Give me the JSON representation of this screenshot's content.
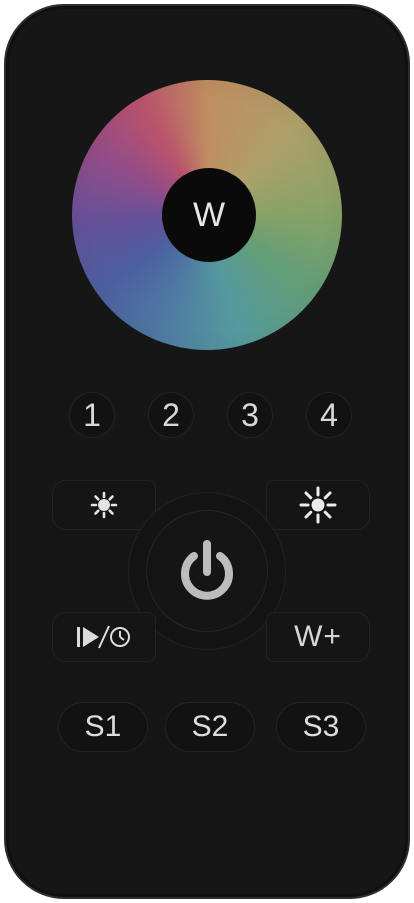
{
  "remote": {
    "color_wheel": {
      "center_label": "W"
    },
    "zone_buttons": [
      {
        "label": "1"
      },
      {
        "label": "2"
      },
      {
        "label": "3"
      },
      {
        "label": "4"
      }
    ],
    "controls": {
      "brightness_down_icon": "sun-small-icon",
      "brightness_up_icon": "sun-large-icon",
      "power_icon": "power-icon",
      "play_timer_icon": "play-timer-icon",
      "white_plus_label": "W+"
    },
    "scene_buttons": [
      {
        "label": "S1"
      },
      {
        "label": "S2"
      },
      {
        "label": "S3"
      }
    ],
    "colors": {
      "body": "#161616",
      "button_text": "#e0e0e0",
      "power_icon": "#bdbdbd"
    }
  }
}
